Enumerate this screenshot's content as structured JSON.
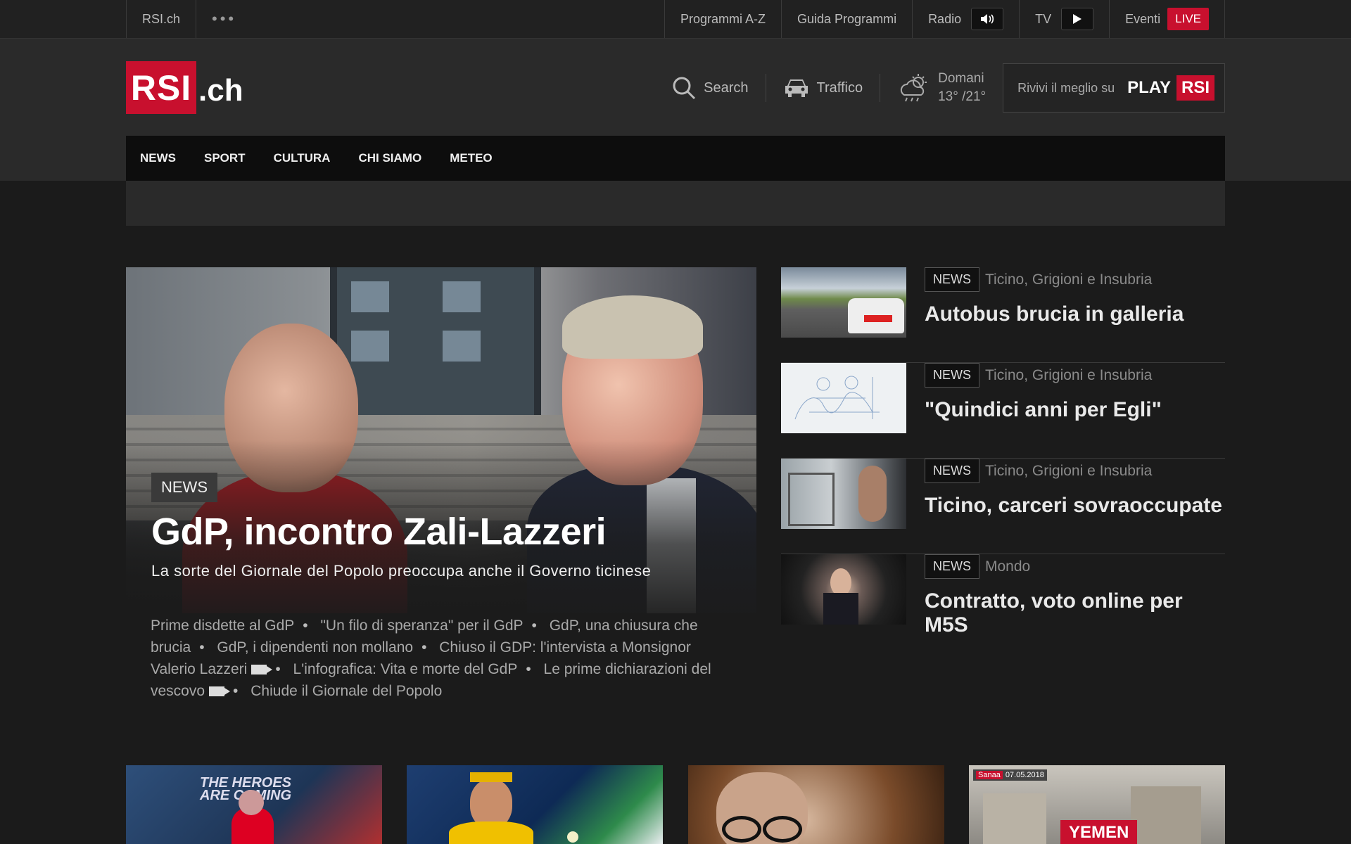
{
  "topbar": {
    "home": "RSI.ch",
    "more": "•••",
    "links": [
      {
        "label": "Programmi A-Z"
      },
      {
        "label": "Guida Programmi"
      },
      {
        "label": "Radio"
      },
      {
        "label": "TV"
      },
      {
        "label": "Eventi",
        "badge": "LIVE"
      }
    ]
  },
  "header": {
    "logo_box": "RSI",
    "logo_suffix": ".ch",
    "search_label": "Search",
    "traffic_label": "Traffico",
    "weather_day": "Domani",
    "weather_temp": "13° /21°",
    "play_text": "Rivivi il meglio su",
    "play_word": "PLAY",
    "play_rsi": "RSI"
  },
  "nav": [
    "NEWS",
    "SPORT",
    "CULTURA",
    "CHI SIAMO",
    "METEO"
  ],
  "hero": {
    "tag": "NEWS",
    "title": "GdP, incontro Zali-Lazzeri",
    "subtitle": "La sorte del Giornale del Popolo preoccupa anche il Governo ticinese",
    "related": [
      {
        "text": "Prime disdette al GdP",
        "video": false
      },
      {
        "text": "\"Un filo di speranza\" per il GdP",
        "video": false
      },
      {
        "text": "GdP, una chiusura che brucia",
        "video": false
      },
      {
        "text": "GdP, i dipendenti non mollano",
        "video": false
      },
      {
        "text": "Chiuso il GDP: l'intervista a Monsignor Valerio Lazzeri",
        "video": true
      },
      {
        "text": "L'infografica: Vita e morte del GdP",
        "video": false
      },
      {
        "text": "Le prime dichiarazioni del vescovo",
        "video": true
      },
      {
        "text": "Chiude il Giornale del Popolo",
        "video": false
      }
    ]
  },
  "side_items": [
    {
      "badge": "NEWS",
      "category": "Ticino, Grigioni e Insubria",
      "title": "Autobus brucia in galleria"
    },
    {
      "badge": "NEWS",
      "category": "Ticino, Grigioni e Insubria",
      "title": "\"Quindici anni per Egli\""
    },
    {
      "badge": "NEWS",
      "category": "Ticino, Grigioni e Insubria",
      "title": "Ticino, carceri sovraoccupate"
    },
    {
      "badge": "NEWS",
      "category": "Mondo",
      "title": "Contratto, voto online per M5S"
    }
  ],
  "cards": {
    "card1_text_line1": "THE HEROES",
    "card1_text_line2": "ARE COMING",
    "card4_stamp_place": "Sanaa",
    "card4_stamp_date": "07.05.2018",
    "card4_label": "YEMEN"
  },
  "colors": {
    "brand_red": "#c8102e",
    "bg": "#1b1b1b",
    "nav_bg": "#0d0d0d"
  }
}
